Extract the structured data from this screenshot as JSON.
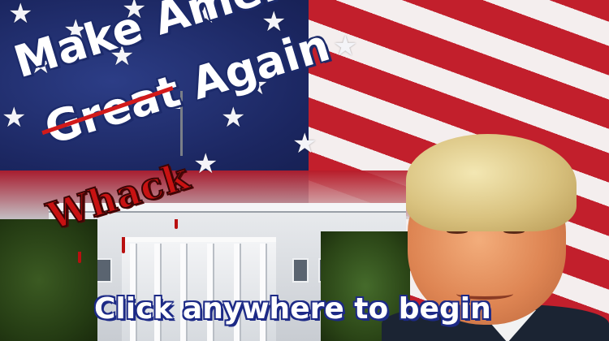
{
  "screen": {
    "title_line1": "Make America",
    "title_struck_word": "Great",
    "title_line2_rest": " Again",
    "replacement_word": "Whack",
    "cta_text": "Click anywhere to begin"
  },
  "colors": {
    "flag_blue": "#1b2660",
    "flag_red": "#c21f2c",
    "text_outline": "#1c2a6a",
    "whack_red": "#c81212"
  },
  "icons": {
    "star": "★"
  }
}
